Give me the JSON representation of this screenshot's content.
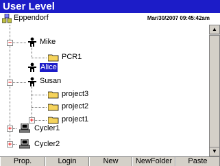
{
  "window": {
    "title": "User Level"
  },
  "header": {
    "root_label": "Eppendorf",
    "timestamp": "Mar/30/2007 09:45:42am"
  },
  "tree": {
    "mike": "Mike",
    "pcr1": "PCR1",
    "alice": "Alice",
    "susan": "Susan",
    "project3": "project3",
    "project2": "project2",
    "project1": "project1",
    "cycler1": "Cycler1",
    "cycler2": "Cycler2"
  },
  "expanders": {
    "minus": "−",
    "plus": "+"
  },
  "scrollbar": {
    "up": "▲",
    "down": "▼"
  },
  "toolbar": {
    "prop": "Prop.",
    "login": "Login",
    "new": "New",
    "newfolder": "NewFolder",
    "paste": "Paste"
  },
  "colors": {
    "title_bg": "#1c1cc8",
    "selection_bg": "#1c1cc8",
    "folder": "#f5d35c",
    "expander_sign": "#e00000"
  }
}
